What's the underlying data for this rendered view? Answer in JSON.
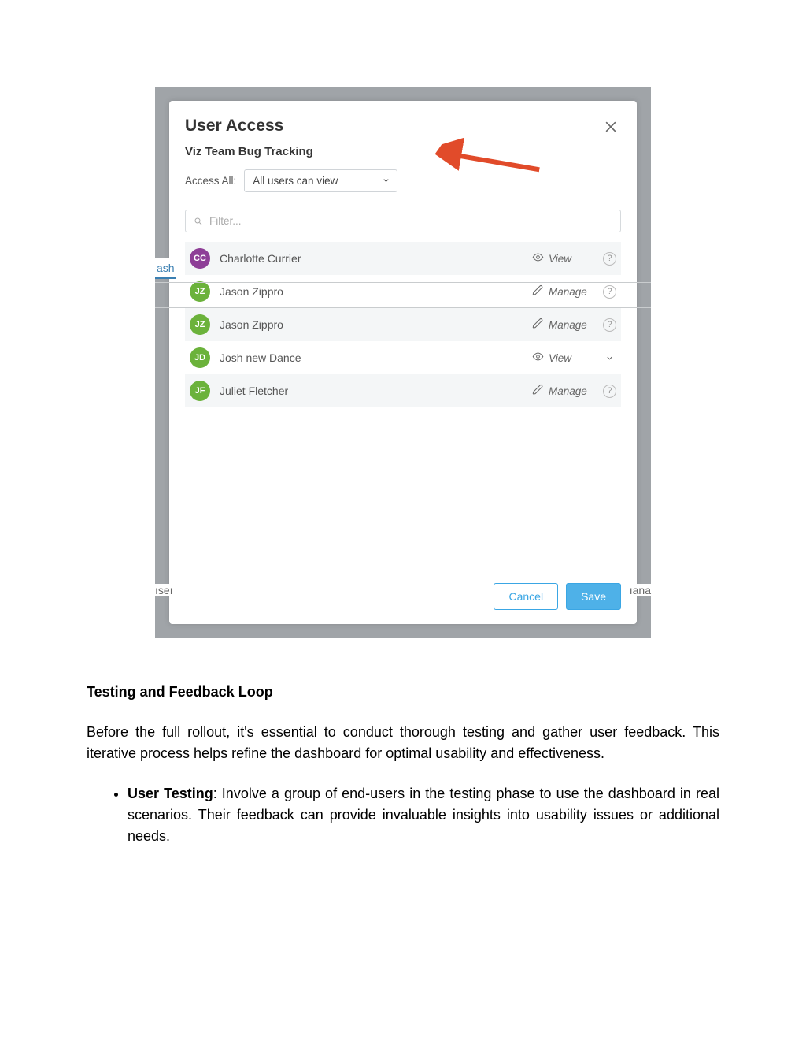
{
  "modal": {
    "title": "User Access",
    "subtitle": "Viz Team Bug Tracking",
    "access_all_label": "Access All:",
    "access_all_value": "All users can view",
    "filter_placeholder": "Filter...",
    "cancel": "Cancel",
    "save": "Save"
  },
  "users": [
    {
      "initials": "CC",
      "name": "Charlotte Currier",
      "avatar_color": "#8e3e97",
      "permission": "View",
      "perm_icon": "eye",
      "end": "help"
    },
    {
      "initials": "JZ",
      "name": "Jason Zippro",
      "avatar_color": "#6bb23b",
      "permission": "Manage",
      "perm_icon": "pencil",
      "end": "help"
    },
    {
      "initials": "JZ",
      "name": "Jason Zippro",
      "avatar_color": "#6bb23b",
      "permission": "Manage",
      "perm_icon": "pencil",
      "end": "help"
    },
    {
      "initials": "JD",
      "name": "Josh new Dance",
      "avatar_color": "#6bb23b",
      "permission": "View",
      "perm_icon": "eye",
      "end": "chev"
    },
    {
      "initials": "JF",
      "name": "Juliet Fletcher",
      "avatar_color": "#6bb23b",
      "permission": "Manage",
      "perm_icon": "pencil",
      "end": "help"
    }
  ],
  "bg": {
    "tab1": "ash",
    "tab2": "ıseı",
    "tab3": "ıana"
  },
  "doc": {
    "heading": "Testing and Feedback Loop",
    "para": "Before the full rollout, it's essential to conduct thorough testing and gather user feedback. This iterative process helps refine the dashboard for optimal usability and effectiveness.",
    "bullet_bold": "User Testing",
    "bullet_rest": ": Involve a group of end-users in the testing phase to use the dashboard in real scenarios. Their feedback can provide invaluable insights into usability issues or additional needs."
  }
}
